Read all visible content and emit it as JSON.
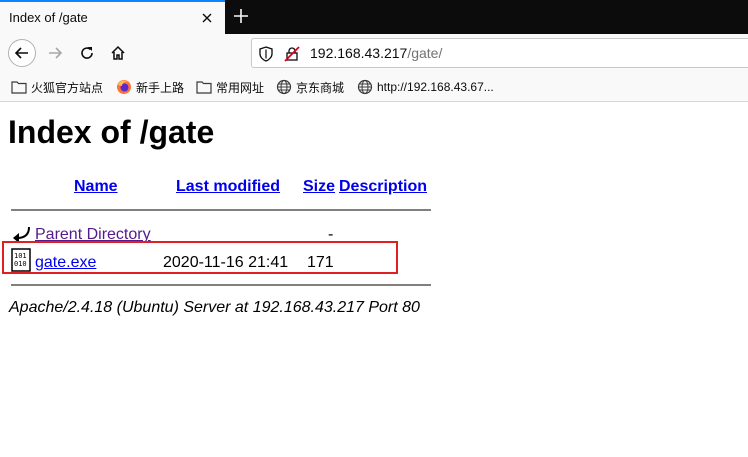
{
  "tab": {
    "title": "Index of /gate"
  },
  "urlbar": {
    "host": "192.168.43.217",
    "path": "/gate/"
  },
  "bookmarks": [
    {
      "label": "火狐官方站点",
      "icon": "folder-icon"
    },
    {
      "label": "新手上路",
      "icon": "firefox-icon"
    },
    {
      "label": "常用网址",
      "icon": "folder-icon"
    },
    {
      "label": "京东商城",
      "icon": "globe-icon"
    },
    {
      "label": "http://192.168.43.67...",
      "icon": "globe-icon"
    }
  ],
  "page": {
    "heading": "Index of /gate",
    "columns": {
      "name": "Name",
      "last_modified": "Last modified",
      "size": "Size",
      "description": "Description"
    },
    "rows": [
      {
        "name": "Parent Directory",
        "last_modified": "",
        "size": "-",
        "icon": "back-arrow-icon"
      },
      {
        "name": "gate.exe",
        "last_modified": "2020-11-16 21:41",
        "size": "171",
        "icon": "binary-file-icon"
      }
    ],
    "footer": "Apache/2.4.18 (Ubuntu) Server at 192.168.43.217 Port 80"
  },
  "colors": {
    "link": "#0000ee",
    "visited_link": "#551a8b",
    "highlight_box": "#e02020",
    "tab_accent": "#0a84ff"
  }
}
